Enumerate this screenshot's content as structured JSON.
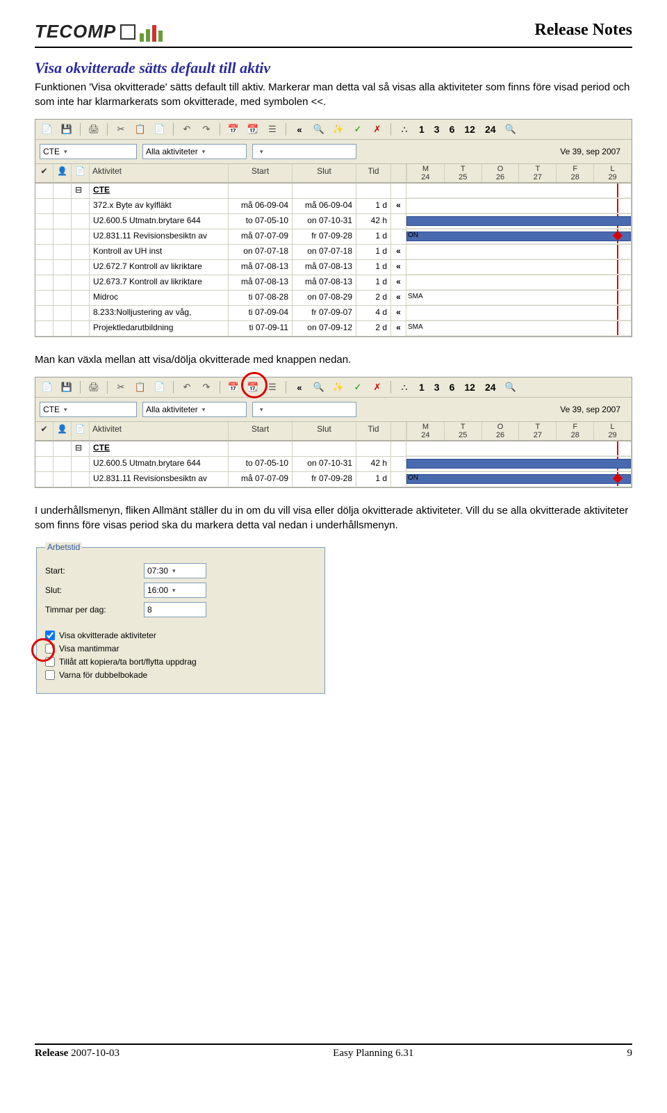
{
  "header": {
    "logo_text": "TECOMP",
    "release_notes": "Release Notes"
  },
  "section": {
    "title": "Visa okvitterade sätts default till aktiv",
    "para1": "Funktionen 'Visa okvitterade' sätts default till aktiv. Markerar man detta val så visas alla aktiviteter som finns före visad period och som inte har klarmarkerats som okvitterade, med symbolen <<.",
    "para2": "Man kan växla mellan att visa/dölja okvitterade med knappen nedan.",
    "para3": "I underhållsmenyn, fliken Allmänt ställer du in om du vill visa eller dölja okvitterade aktiviteter. Vill du se alla okvitterade aktiviteter som finns före visas period ska du markera detta val nedan i underhållsmenyn."
  },
  "toolbar": {
    "numbers": [
      "1",
      "3",
      "6",
      "12",
      "24"
    ]
  },
  "filter": {
    "combo1": "CTE",
    "combo2": "Alla aktiviteter",
    "combo3": "",
    "week": "Ve 39, sep 2007"
  },
  "columns": {
    "aktivitet": "Aktivitet",
    "start": "Start",
    "slut": "Slut",
    "tid": "Tid"
  },
  "days": {
    "names": [
      "M",
      "T",
      "O",
      "T",
      "F",
      "L"
    ],
    "nums": [
      "24",
      "25",
      "26",
      "27",
      "28",
      "29"
    ]
  },
  "rows1": [
    {
      "name": "CTE",
      "start": "",
      "slut": "",
      "tid": "",
      "mark": "",
      "group": true
    },
    {
      "name": "372.x Byte av kylfläkt",
      "start": "må 06-09-04",
      "slut": "må 06-09-04",
      "tid": "1 d",
      "mark": "«"
    },
    {
      "name": "U2.600.5 Utmatn.brytare 644",
      "start": "to 07-05-10",
      "slut": "on 07-10-31",
      "tid": "42 h",
      "mark": "",
      "bar": true
    },
    {
      "name": "U2.831.11 Revisionsbesiktn av",
      "start": "må 07-07-09",
      "slut": "fr 07-09-28",
      "tid": "1 d",
      "mark": "",
      "bar": true,
      "diamond": true,
      "tag": "ON"
    },
    {
      "name": "Kontroll av UH inst",
      "start": "on 07-07-18",
      "slut": "on 07-07-18",
      "tid": "1 d",
      "mark": "«"
    },
    {
      "name": "U2.672.7 Kontroll av likriktare",
      "start": "må 07-08-13",
      "slut": "må 07-08-13",
      "tid": "1 d",
      "mark": "«"
    },
    {
      "name": "U2.673.7 Kontroll av likriktare",
      "start": "må 07-08-13",
      "slut": "må 07-08-13",
      "tid": "1 d",
      "mark": "«"
    },
    {
      "name": "Midroc",
      "start": "ti 07-08-28",
      "slut": "on 07-08-29",
      "tid": "2 d",
      "mark": "«",
      "tag": "SMA"
    },
    {
      "name": "8.233:Nolljustering av våg,",
      "start": "ti 07-09-04",
      "slut": "fr 07-09-07",
      "tid": "4 d",
      "mark": "«"
    },
    {
      "name": "Projektledarutbildning",
      "start": "ti 07-09-11",
      "slut": "on 07-09-12",
      "tid": "2 d",
      "mark": "«",
      "tag": "SMA"
    }
  ],
  "rows2": [
    {
      "name": "CTE",
      "start": "",
      "slut": "",
      "tid": "",
      "mark": "",
      "group": true
    },
    {
      "name": "U2.600.5 Utmatn.brytare 644",
      "start": "to 07-05-10",
      "slut": "on 07-10-31",
      "tid": "42 h",
      "mark": "",
      "bar": true
    },
    {
      "name": "U2.831.11 Revisionsbesiktn av",
      "start": "må 07-07-09",
      "slut": "fr 07-09-28",
      "tid": "1 d",
      "mark": "",
      "bar": true,
      "diamond": true,
      "tag": "ON"
    }
  ],
  "options": {
    "legend": "Arbetstid",
    "start_lbl": "Start:",
    "start_val": "07:30",
    "slut_lbl": "Slut:",
    "slut_val": "16:00",
    "tpd_lbl": "Timmar per dag:",
    "tpd_val": "8",
    "chk1": "Visa okvitterade aktiviteter",
    "chk2": "Visa mantimmar",
    "chk3": "Tillåt att kopiera/ta bort/flytta uppdrag",
    "chk4": "Varna för dubbelbokade"
  },
  "footer": {
    "release_lbl": "Release",
    "release_date": " 2007-10-03",
    "product": "Easy Planning 6.31",
    "page": "9"
  }
}
